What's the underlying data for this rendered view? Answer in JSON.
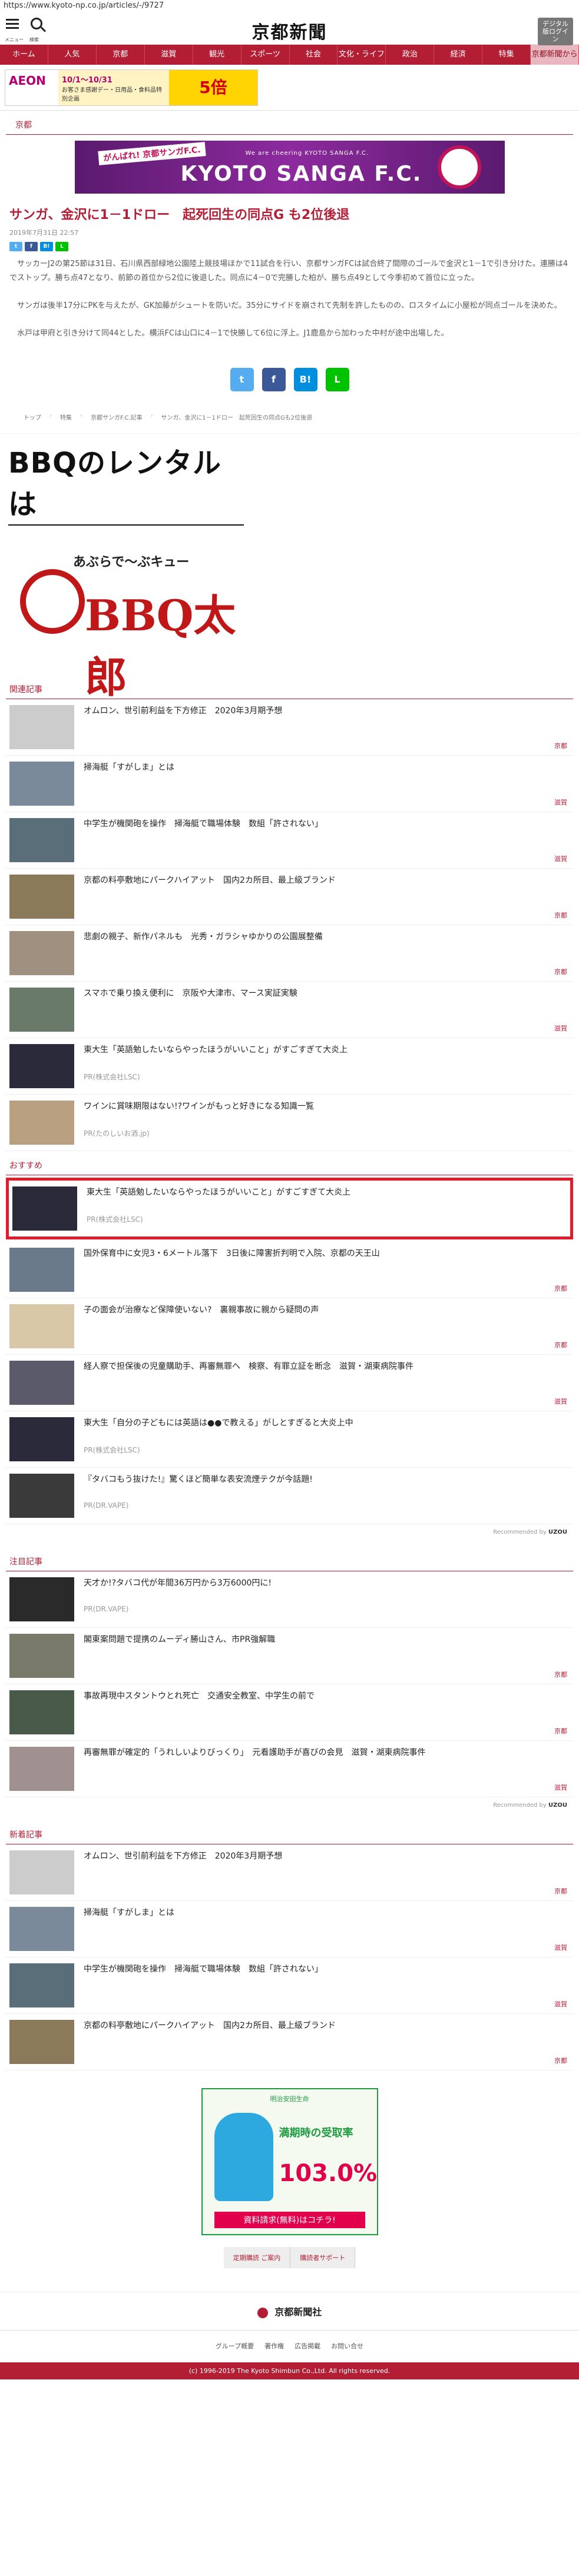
{
  "url": "https://www.kyoto-np.co.jp/articles/-/9727",
  "header": {
    "menu_label": "メニュー",
    "search_label": "検索",
    "logo": "京都新聞",
    "digital_btn": "デジタル版ログイン"
  },
  "nav": [
    "ホーム",
    "人気",
    "京都",
    "滋賀",
    "観光",
    "スポーツ",
    "社会",
    "文化・ライフ",
    "政治",
    "経済",
    "特集",
    "京都新聞から"
  ],
  "top_ad": {
    "brand": "AEON",
    "date": "10/1〜10/31",
    "caption": "お客さま感謝デー・日用品・食料品特別企画",
    "points": "5倍"
  },
  "section": "京都",
  "banner": {
    "cheer": "がんばれ! 京都サンガF.C.",
    "tag": "We are cheering KYOTO SANGA F.C.",
    "team": "KYOTO SANGA F.C."
  },
  "article": {
    "title": "サンガ、金沢に1－1ドロー　起死回生の同点G も2位後退",
    "timestamp": "2019年7月31日 22:57",
    "paragraphs": [
      "　サッカーJ2の第25節は31日、石川県西部緑地公園陸上競技場ほかで11試合を行い、京都サンガFCは試合終了間際のゴールで金沢と1－1で引き分けた。連勝は4でストップ。勝ち点47となり、前節の首位から2位に後退した。同点に4－0で完勝した柏が、勝ち点49として今季初めて首位に立った。",
      "　サンガは後半17分にPKを与えたが、GK加藤がシュートを防いだ。35分にサイドを崩されて先制を許したものの、ロスタイムに小屋松が同点ゴールを決めた。",
      "　水戸は甲府と引き分けて同44とした。横浜FCは山口に4－1で快勝して6位に浮上。J1鹿島から加わった中村が途中出場した。"
    ]
  },
  "breadcrumbs": [
    "トップ",
    "特集",
    "京都サンガF.C.記事",
    "サンガ、金沢に1－1ドロー　起死回生の同点Gも2位後退"
  ],
  "bbq_ad": {
    "title": "BBQのレンタルは",
    "sub": "あぶらで～ぶキュー",
    "logo": "BBQ太郎"
  },
  "related": {
    "header": "関連記事",
    "items": [
      {
        "title": "オムロン、世引前利益を下方修正　2020年3月期予想",
        "region": "京都",
        "sponsor": "",
        "color": "#ccc"
      },
      {
        "title": "掃海艇「すがしま」とは",
        "region": "滋賀",
        "sponsor": "",
        "color": "#7a8a9a"
      },
      {
        "title": "中学生が機関砲を操作　掃海艇で職場体験　数組「許されない」",
        "region": "滋賀",
        "sponsor": "",
        "color": "#5a6e7a"
      },
      {
        "title": "京都の料亭敷地にパークハイアット　国内2カ所目、最上級ブランド",
        "region": "京都",
        "sponsor": "",
        "color": "#8a7a5a"
      },
      {
        "title": "悲劇の親子、新作パネルも　光秀・ガラシャゆかりの公園展整備",
        "region": "京都",
        "sponsor": "",
        "color": "#a09080"
      },
      {
        "title": "スマホで乗り換え便利に　京阪や大津市、マース実証実験",
        "region": "滋賀",
        "sponsor": "",
        "color": "#6a7a6a"
      },
      {
        "title": "東大生「英語勉したいならやったほうがいいこと」がすごすぎて大炎上",
        "region": "",
        "sponsor": "PR(株式会社LSC)",
        "color": "#2a2a3a"
      },
      {
        "title": "ワインに賞味期限はない!?ワインがもっと好きになる知識一覧",
        "region": "",
        "sponsor": "PR(たのしいお酒.jp)",
        "color": "#b8a080"
      }
    ]
  },
  "recommend": {
    "header": "おすすめ",
    "items": [
      {
        "title": "東大生「英語勉したいならやったほうがいいこと」がすごすぎて大炎上",
        "region": "",
        "sponsor": "PR(株式会社LSC)",
        "color": "#2a2a3a",
        "highlight": true
      },
      {
        "title": "国外保育中に女児3・6メートル落下　3日後に障害折判明で入院、京都の天王山",
        "region": "京都",
        "sponsor": "",
        "color": "#6a7a8a",
        "highlight": false
      },
      {
        "title": "子の面会が治療など保障使いない?　裏親事故に親から疑問の声",
        "region": "京都",
        "sponsor": "",
        "color": "#d8c8a8",
        "highlight": false
      },
      {
        "title": "経人察で担保後の児童購助手、再審無罪へ　検察、有罪立証を断念　滋賀・湖東病院事件",
        "region": "滋賀",
        "sponsor": "",
        "color": "#5a5a6a",
        "highlight": false
      },
      {
        "title": "東大生「自分の子どもには英語は●●で教える」がしとすぎると大炎上中",
        "region": "",
        "sponsor": "PR(株式会社LSC)",
        "color": "#2a2a3a",
        "highlight": false
      },
      {
        "title": "『タバコもう抜けた!』驚くほど簡単な表安流煙テクが今話題!",
        "region": "",
        "sponsor": "PR(DR.VAPE)",
        "color": "#3a3a3a",
        "highlight": false
      }
    ],
    "powered": "Recommended by",
    "brand": "UZOU"
  },
  "notable": {
    "header": "注目記事",
    "items": [
      {
        "title": "天才か!?タバコ代が年間36万円から3万6000円に!",
        "region": "",
        "sponsor": "PR(DR.VAPE)",
        "color": "#2a2a2a"
      },
      {
        "title": "閣東案問題で提携のムーディ勝山さん、市PR強解職",
        "region": "京都",
        "sponsor": "",
        "color": "#7a7a6a"
      },
      {
        "title": "事故再現中スタントウとれ死亡　交通安全教室、中学生の前で",
        "region": "京都",
        "sponsor": "",
        "color": "#4a5a4a"
      },
      {
        "title": "再審無罪が確定的「うれしいよりびっくり」　元看護助手が喜びの会見　滋賀・湖東病院事件",
        "region": "滋賀",
        "sponsor": "",
        "color": "#a09090"
      }
    ],
    "powered": "Recommended by",
    "brand": "UZOU"
  },
  "latest": {
    "header": "新着記事",
    "items": [
      {
        "title": "オムロン、世引前利益を下方修正　2020年3月期予想",
        "region": "京都",
        "sponsor": "",
        "color": "#ccc"
      },
      {
        "title": "掃海艇「すがしま」とは",
        "region": "滋賀",
        "sponsor": "",
        "color": "#7a8a9a"
      },
      {
        "title": "中学生が機関砲を操作　掃海艇で職場体験　数組「許されない」",
        "region": "滋賀",
        "sponsor": "",
        "color": "#5a6e7a"
      },
      {
        "title": "京都の料亭敷地にパークハイアット　国内2カ所目、最上級ブランド",
        "region": "京都",
        "sponsor": "",
        "color": "#8a7a5a"
      }
    ]
  },
  "bottom_ad": {
    "t1": "明治安田生命",
    "t2": "満期時の受取率",
    "t3": "103.0%",
    "t4": "資料請求(無料)はコチラ!"
  },
  "footer": {
    "links": [
      "定期購読 ご案内",
      "購読者サポート"
    ],
    "logo": "京都新聞社",
    "nav": [
      "グループ概要",
      "著作権",
      "広告掲載",
      "お問い合せ"
    ],
    "copyright": "(c) 1996-2019 The Kyoto Shimbun Co.,Ltd. All rights reserved."
  },
  "colors": {
    "brand": "#b41e35",
    "highlight": "#e21c2a"
  }
}
